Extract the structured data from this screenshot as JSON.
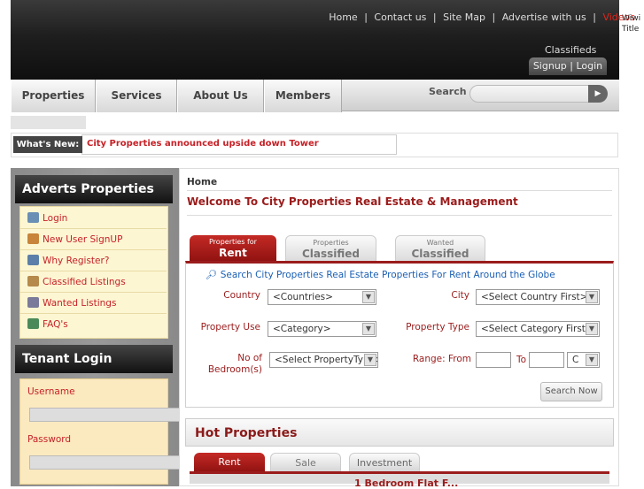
{
  "header": {
    "top_links": [
      "Home",
      "Contact us",
      "Site Map",
      "Advertise with us",
      "Videos"
    ],
    "separator": "|",
    "classifieds_label": "Classifieds",
    "signup_login": "Signup | Login",
    "side_note": "Wiwi Title"
  },
  "nav": {
    "tabs": [
      "Properties",
      "Services",
      "About Us",
      "Members"
    ],
    "search_label": "Search",
    "search_button": "▶"
  },
  "whats_new": {
    "label": "What's New:",
    "text": "City Properties announced upside down Tower"
  },
  "sidebar": {
    "adverts_title": "Adverts Properties",
    "items": [
      {
        "label": "Login",
        "icon": "login-icon"
      },
      {
        "label": "New User SignUP",
        "icon": "user-signup-icon"
      },
      {
        "label": "Why Register?",
        "icon": "register-icon"
      },
      {
        "label": "Classified Listings",
        "icon": "home-icon"
      },
      {
        "label": "Wanted Listings",
        "icon": "building-icon"
      },
      {
        "label": "FAQ's",
        "icon": "faq-icon"
      }
    ],
    "tenant_title": "Tenant Login",
    "username_label": "Username",
    "password_label": "Password"
  },
  "main": {
    "breadcrumb": "Home",
    "welcome": "Welcome To City Properties Real Estate & Management",
    "tabs": [
      {
        "small": "Properties for",
        "big": "Rent"
      },
      {
        "small": "Properties",
        "big": "Classified"
      },
      {
        "small": "Wanted",
        "big": "Classified"
      }
    ],
    "search_hint": "Search City Properties Real Estate Properties For Rent Around the Globe",
    "form": {
      "country_label": "Country",
      "country_value": "<Countries>",
      "city_label": "City",
      "city_value": "<Select Country First>",
      "property_use_label": "Property Use",
      "property_use_value": "<Category>",
      "property_type_label": "Property Type",
      "property_type_value": "<Select Category First>",
      "bedrooms_label": "No of Bedroom(s)",
      "bedrooms_value": "<Select PropertyType>",
      "range_label": "Range: From",
      "to_label": "To",
      "currency_value": "C",
      "search_now": "Search Now"
    },
    "hot": {
      "title": "Hot Properties",
      "tabs": [
        "Rent",
        "Sale",
        "Investment"
      ],
      "first_item": "1 Bedroom Flat F..."
    }
  },
  "colors": {
    "accent": "#9b1c1c",
    "link_red": "#c62127",
    "videos_red": "#e0241b",
    "hint_blue": "#1a5fb4"
  }
}
